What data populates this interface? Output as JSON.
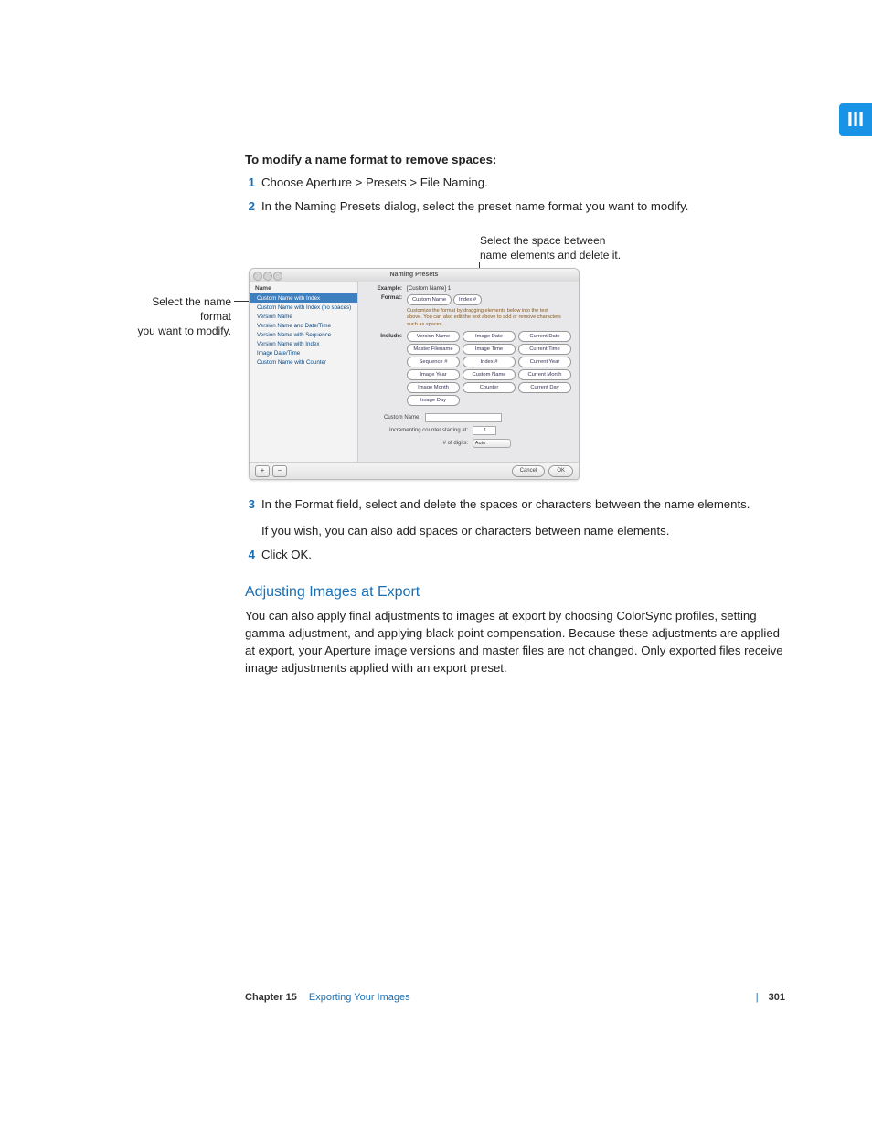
{
  "tab_label": "III",
  "procedure_title": "To modify a name format to remove spaces:",
  "steps": {
    "s1": "Choose Aperture > Presets > File Naming.",
    "s2": "In the Naming Presets dialog, select the preset name format you want to modify.",
    "s3": "In the Format field, select and delete the spaces or characters between the name elements.",
    "s3b": "If you wish, you can also add spaces or characters between name elements.",
    "s4": "Click OK."
  },
  "callouts": {
    "right_line1": "Select the space between",
    "right_line2": "name elements and delete it.",
    "left_line1": "Select the name format",
    "left_line2": "you want to modify."
  },
  "dialog": {
    "title": "Naming Presets",
    "sidebar_header": "Name",
    "presets": [
      "Custom Name with Index",
      "Custom Name with Index (no spaces)",
      "Version Name",
      "Version Name and Date/Time",
      "Version Name with Sequence",
      "Version Name with Index",
      "Image Date/Time",
      "Custom Name with Counter"
    ],
    "example_label": "Example:",
    "example_value": "[Custom Name] 1",
    "format_label": "Format:",
    "format_tokens": [
      "Custom Name",
      "Index #"
    ],
    "hint": "Customize the format by dragging elements below into the text above. You can also edit the text above to add or remove characters such as spaces.",
    "include_label": "Include:",
    "include_items": [
      "Version Name",
      "Image Date",
      "Current Date",
      "Master Filename",
      "Image Time",
      "Current Time",
      "Sequence #",
      "Index #",
      "Current Year",
      "Image Year",
      "Custom Name",
      "Current Month",
      "Image Month",
      "Counter",
      "Current Day",
      "Image Day"
    ],
    "custom_name_label": "Custom Name:",
    "counter_label": "Incrementing counter starting at:",
    "counter_value": "1",
    "digits_label": "# of digits:",
    "digits_value": "Auto",
    "add_btn": "+",
    "remove_btn": "−",
    "cancel_btn": "Cancel",
    "ok_btn": "OK"
  },
  "section_heading": "Adjusting Images at Export",
  "section_body": "You can also apply final adjustments to images at export by choosing ColorSync profiles, setting gamma adjustment, and applying black point compensation. Because these adjustments are applied at export, your Aperture image versions and master files are not changed. Only exported files receive image adjustments applied with an export preset.",
  "footer": {
    "chapter": "Chapter 15",
    "title": "Exporting Your Images",
    "page": "301"
  }
}
